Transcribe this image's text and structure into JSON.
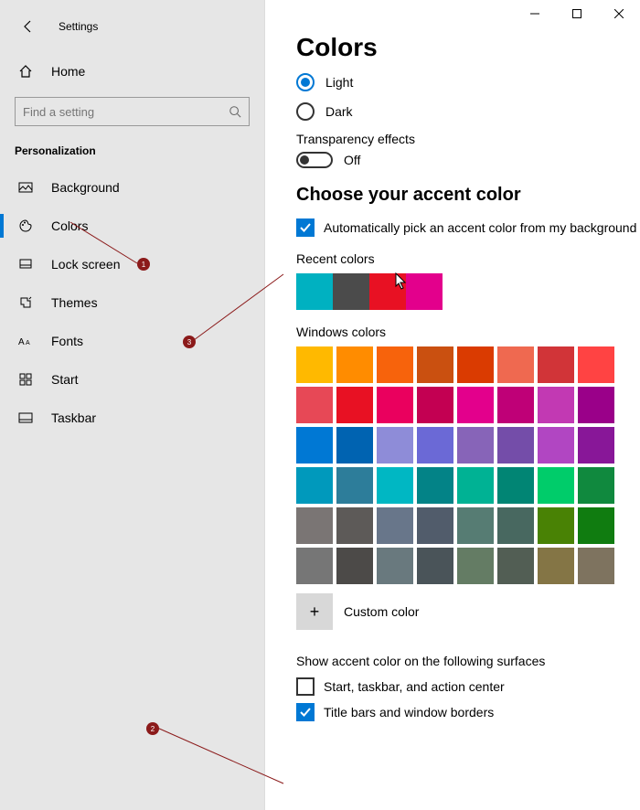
{
  "window": {
    "title": "Settings"
  },
  "sidebar": {
    "home": "Home",
    "search_placeholder": "Find a setting",
    "section": "Personalization",
    "items": [
      {
        "label": "Background"
      },
      {
        "label": "Colors"
      },
      {
        "label": "Lock screen"
      },
      {
        "label": "Themes"
      },
      {
        "label": "Fonts"
      },
      {
        "label": "Start"
      },
      {
        "label": "Taskbar"
      }
    ]
  },
  "main": {
    "heading": "Colors",
    "mode": {
      "light": "Light",
      "dark": "Dark",
      "selected": "light"
    },
    "transparency": {
      "label": "Transparency effects",
      "state": "Off"
    },
    "accent_heading": "Choose your accent color",
    "auto_pick": {
      "label": "Automatically pick an accent color from my background",
      "checked": true
    },
    "recent_label": "Recent colors",
    "recent_colors": [
      "#00b1c1",
      "#4b4b4b",
      "#e81123",
      "#e3008c"
    ],
    "windows_label": "Windows colors",
    "windows_colors": [
      "#ffb900",
      "#ff8c00",
      "#f7630c",
      "#ca5010",
      "#da3b01",
      "#ef6950",
      "#d13438",
      "#ff4343",
      "#e74856",
      "#e81123",
      "#ea005e",
      "#c30052",
      "#e3008c",
      "#bf0077",
      "#c239b3",
      "#9a0089",
      "#0078d4",
      "#0063b1",
      "#8e8cd8",
      "#6b69d6",
      "#8764b8",
      "#744da9",
      "#b146c2",
      "#881798",
      "#0099bc",
      "#2d7d9a",
      "#00b7c3",
      "#038387",
      "#00b294",
      "#018574",
      "#00cc6a",
      "#10893e",
      "#7a7574",
      "#5d5a58",
      "#68768a",
      "#515c6b",
      "#567c73",
      "#486860",
      "#498205",
      "#107c10",
      "#767676",
      "#4c4a48",
      "#69797e",
      "#4a5459",
      "#647c64",
      "#525e54",
      "#847545",
      "#7e735f"
    ],
    "custom_label": "Custom color",
    "surfaces_heading": "Show accent color on the following surfaces",
    "surface1": {
      "label": "Start, taskbar, and action center",
      "checked": false
    },
    "surface2": {
      "label": "Title bars and window borders",
      "checked": true
    }
  },
  "annotations": [
    "1",
    "2",
    "3"
  ]
}
